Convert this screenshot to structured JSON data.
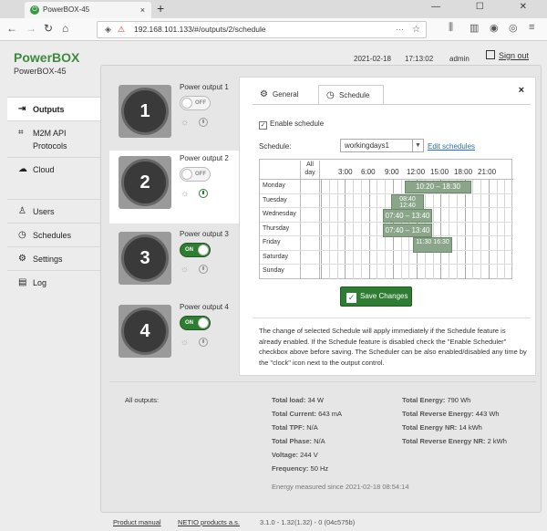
{
  "browser": {
    "tab_title": "PowerBOX-45",
    "tab_close": "×",
    "new_tab": "+",
    "url": "192.168.101.133/#/outputs/2/schedule",
    "window_buttons": "— ☐ ✕"
  },
  "header": {
    "brand": "PowerBOX",
    "model": "PowerBOX-45",
    "date": "2021-02-18",
    "time": "17:13:02",
    "user": "admin",
    "signout": "Sign out"
  },
  "sidebar": {
    "items": [
      {
        "label": "Outputs",
        "icon": "sign-in-icon"
      },
      {
        "label": "M2M API Protocols",
        "icon": "m2m-icon"
      },
      {
        "label": "Cloud",
        "icon": "cloud-icon"
      },
      {
        "label": "Users",
        "icon": "user-icon"
      },
      {
        "label": "Schedules",
        "icon": "clock-icon"
      },
      {
        "label": "Settings",
        "icon": "gear-icon"
      },
      {
        "label": "Log",
        "icon": "log-icon"
      }
    ]
  },
  "outputs": [
    {
      "number": "1",
      "name": "Power output 1",
      "state": "OFF",
      "scheduler": false
    },
    {
      "number": "2",
      "name": "Power output 2",
      "state": "OFF",
      "scheduler": true
    },
    {
      "number": "3",
      "name": "Power output 3",
      "state": "ON",
      "scheduler": false
    },
    {
      "number": "4",
      "name": "Power output 4",
      "state": "ON",
      "scheduler": false
    }
  ],
  "dialog": {
    "tab_general": "General",
    "tab_schedule": "Schedule",
    "close": "×",
    "enable_label": "Enable schedule",
    "schedule_label": "Schedule:",
    "schedule_value": "workingdays1",
    "edit_link": "Edit schedules",
    "allday_label": "All day",
    "hours": [
      "3:00",
      "6:00",
      "9:00",
      "12:00",
      "15:00",
      "18:00",
      "21:00"
    ],
    "days": [
      "Monday",
      "Tuesday",
      "Wednesday",
      "Thursday",
      "Friday",
      "Saturday",
      "Sunday"
    ],
    "blocks": [
      {
        "day": "Monday",
        "label": "10:20 – 18:30"
      },
      {
        "day": "Tuesday",
        "label": "08:40 12:40"
      },
      {
        "day": "Wednesday",
        "label": "07:40 – 13:40"
      },
      {
        "day": "Thursday",
        "label": "07:40 – 13:40"
      },
      {
        "day": "Friday",
        "label": "11:30 16:30"
      }
    ],
    "save_label": "Save Changes",
    "note": "The change of selected Schedule will apply immediately if the Schedule feature is already enabled. If the Schedule feature is disabled check the \"Enable Scheduler\" checkbox above before saving. The Scheduler can be also enabled/disabled any time by the \"clock\" icon next to the output control."
  },
  "summary": {
    "all_outputs": "All outputs:",
    "total_load_l": "Total load:",
    "total_load_v": "34 W",
    "total_current_l": "Total Current:",
    "total_current_v": "643 mA",
    "total_tpf_l": "Total TPF:",
    "total_tpf_v": "N/A",
    "total_phase_l": "Total Phase:",
    "total_phase_v": "N/A",
    "voltage_l": "Voltage:",
    "voltage_v": "244 V",
    "frequency_l": "Frequency:",
    "frequency_v": "50 Hz",
    "total_energy_l": "Total Energy:",
    "total_energy_v": "790 Wh",
    "total_rev_energy_l": "Total Reverse Energy:",
    "total_rev_energy_v": "443 Wh",
    "total_energy_nr_l": "Total Energy NR:",
    "total_energy_nr_v": "14 kWh",
    "total_rev_energy_nr_l": "Total Reverse Energy NR:",
    "total_rev_energy_nr_v": "2 kWh",
    "energy_since": "Energy measured since 2021-02-18 08:54:14"
  },
  "footer": {
    "manual": "Product manual",
    "products": "NETIO products a.s.",
    "version": "3.1.0 - 1.32(1.32) - 0 (04c575b)"
  }
}
